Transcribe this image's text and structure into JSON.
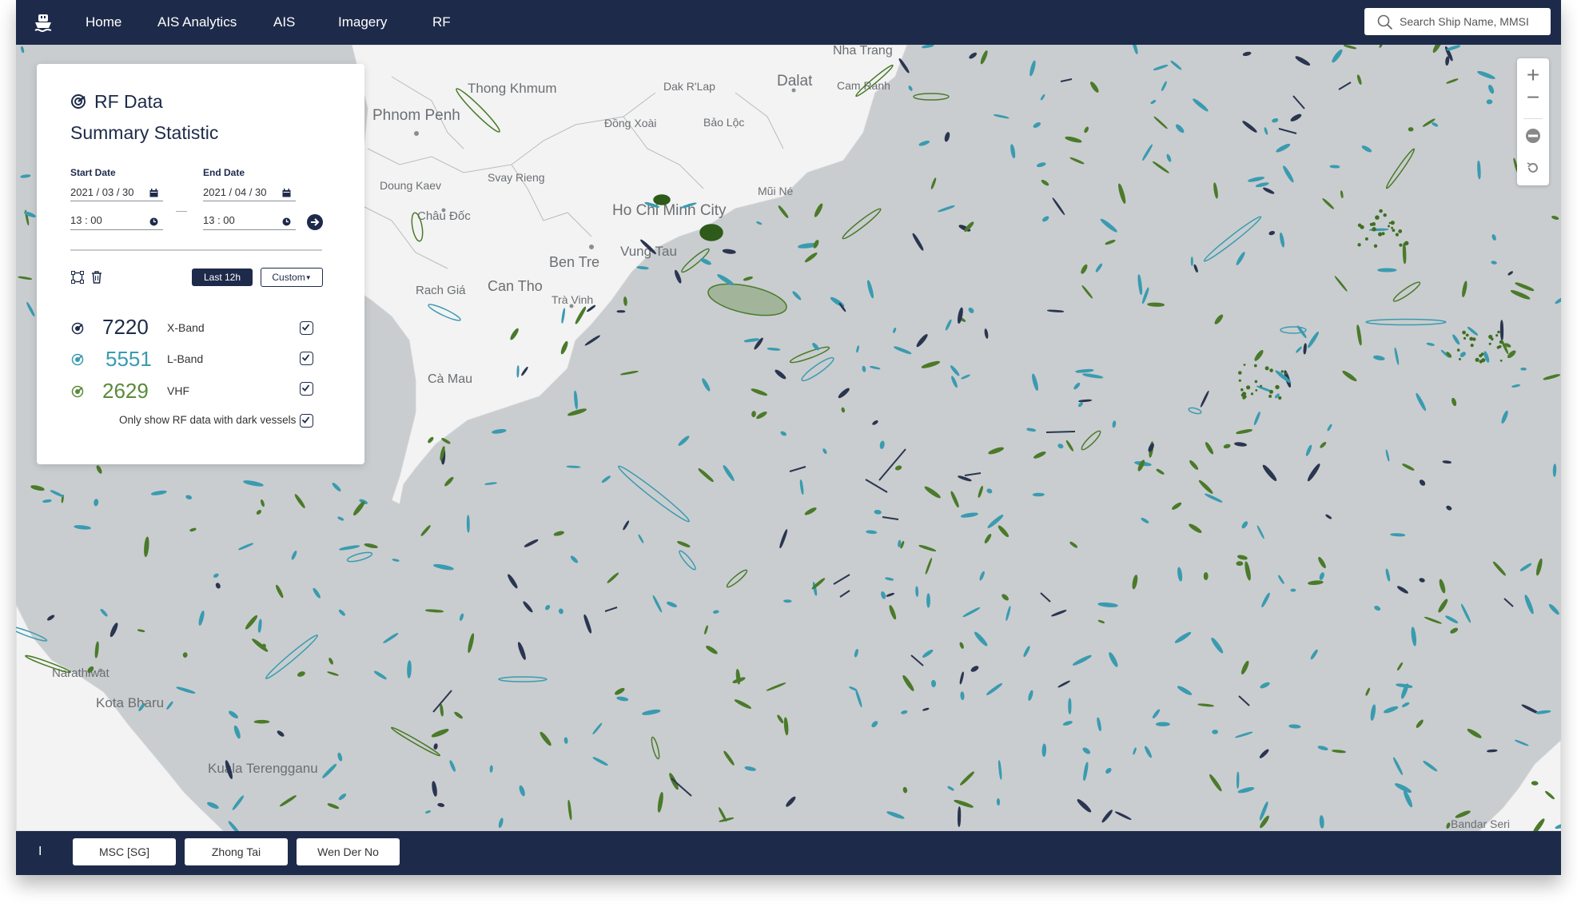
{
  "nav": {
    "items": [
      "Home",
      "AIS Analytics",
      "AIS",
      "Imagery",
      "RF"
    ],
    "search_placeholder": "Search Ship Name, MMSI"
  },
  "panel": {
    "title": "RF Data",
    "subtitle": "Summary Statistic",
    "start_label": "Start Date",
    "start_date": "2021 / 03 / 30",
    "start_time": "13 : 00",
    "end_label": "End Date",
    "end_date": "2021 / 04 / 30",
    "end_time": "13 : 00",
    "last_button": "Last 12h",
    "custom_button": "Custom",
    "bands": [
      {
        "count": "7220",
        "label": "X-Band",
        "color": "#1d2a4a",
        "checked": true
      },
      {
        "count": "5551",
        "label": "L-Band",
        "color": "#3a9bb0",
        "checked": true
      },
      {
        "count": "2629",
        "label": "VHF",
        "color": "#5a8a3a",
        "checked": true
      }
    ],
    "dark_only_label": "Only show RF data with dark vessels",
    "dark_only_checked": true
  },
  "map": {
    "places": [
      "Nha Trang",
      "Dalat",
      "Cam Ranh",
      "Phnom Penh",
      "Thong Khmum",
      "Dak R'Lap",
      "Đồng Xoài",
      "Bảo Lộc",
      "Svay Rieng",
      "Doung Kaev",
      "Châu Đốc",
      "Mũi Né",
      "Ho Chi Minh City",
      "Ben Tre",
      "Vung Tau",
      "Rach Giá",
      "Can Tho",
      "Trà Vinh",
      "Cà Mau",
      "Narathiwat",
      "Kota Bharu",
      "Kuala Terengganu",
      "Bandar Seri"
    ],
    "colors": {
      "sea": "#c9cdcf",
      "land": "#f3f3f3",
      "xband": "#1d2a4a",
      "lband": "#3a9bb0",
      "vhf": "#4a7a2a"
    }
  },
  "zoom": {
    "plus": "+",
    "minus": "−"
  },
  "bottom": {
    "handle": "I",
    "vessels": [
      "MSC [SG]",
      "Zhong Tai",
      "Wen Der No"
    ]
  }
}
